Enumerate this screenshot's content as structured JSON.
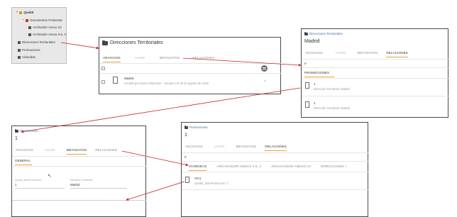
{
  "tree": {
    "root": "Qoobit",
    "items": [
      {
        "label": "Documentos Postventa",
        "color": "#c0392b"
      },
      {
        "label": "Archivador Anexo 10",
        "color": "#555555"
      },
      {
        "label": "Archivador Anexo 4-5, 3",
        "color": "#555555"
      },
      {
        "label": "Direcciones Territoriales",
        "color": "#555555"
      },
      {
        "label": "Promociones",
        "color": "#555555"
      },
      {
        "label": "Viviendas",
        "color": "#555555"
      }
    ]
  },
  "panel1": {
    "title": "Direcciones Territoriales",
    "tabs": [
      "ARCHIVOS",
      "VISOR",
      "METADATOS",
      "RELACIONES"
    ],
    "file": {
      "name": "Madrid",
      "meta": "Creado por Datos Mifuentes - Usuario | el 29 de agosto de 2018"
    }
  },
  "panel2": {
    "breadcrumb": "Direcciones Territoriales",
    "title": "Madrid",
    "tabs": [
      "ARCHIVOS",
      "VISOR",
      "METADATOS",
      "RELACIONES"
    ],
    "count": "0",
    "section": "PROMOCIONES",
    "items": [
      {
        "name": "1",
        "meta": "Dirección Territorial: Madrid"
      },
      {
        "name": "2",
        "meta": "Dirección Territorial: Madrid"
      }
    ]
  },
  "panel3": {
    "breadcrumb": "Promociones",
    "title": "1",
    "tabs": [
      "ARCHIVOS",
      "VISOR",
      "METADATOS",
      "RELACIONES"
    ],
    "section": "GENERAL",
    "fields": [
      {
        "label": "Qoobit_NumPromocion",
        "value": "1"
      },
      {
        "label": "Dirección Territorial",
        "value": "Madrid"
      }
    ]
  },
  "panel4": {
    "breadcrumb": "Promociones",
    "title": "1",
    "tabs": [
      "ARCHIVOS",
      "VISOR",
      "METADATOS",
      "RELACIONES"
    ],
    "count": "0",
    "subtabs": [
      "VIVIENDAS",
      "ARCHIVADOR ANEXO 4-5, 3",
      "ARCHIVADOR ANEXO 10",
      "DIRECCIONES"
    ],
    "item": {
      "name": "VIV1",
      "meta": "Qoobit_NumPromocion: 1"
    }
  },
  "colors": {
    "accent": "#e7a23a",
    "arrow": "#cc2222",
    "link": "#3d6ea8"
  }
}
